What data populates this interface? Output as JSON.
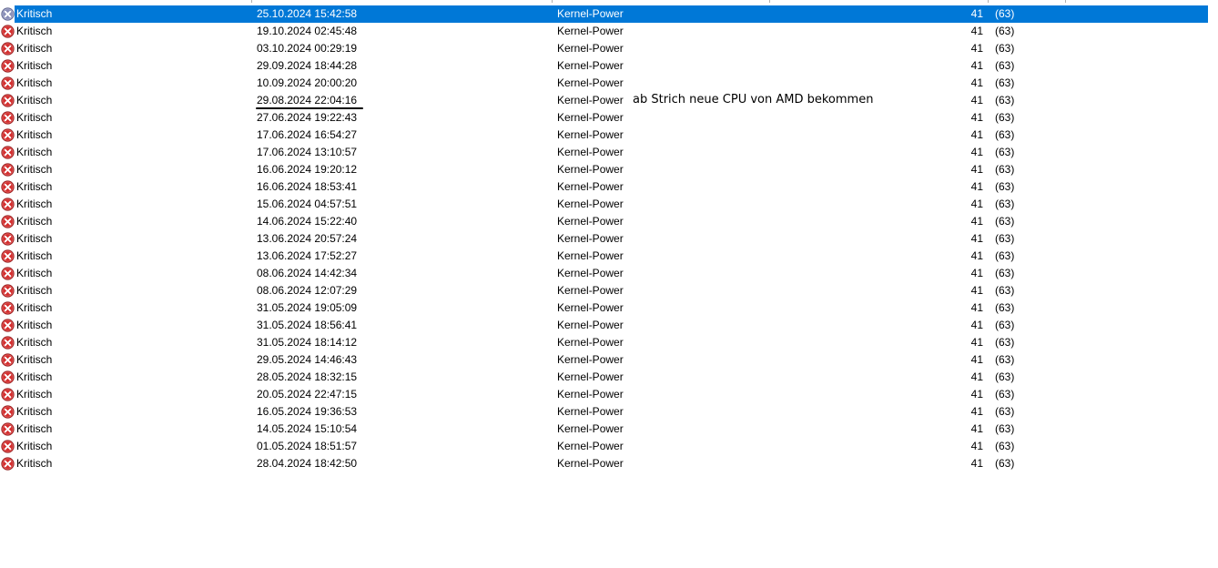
{
  "events": [
    {
      "level": "Kritisch",
      "date": "25.10.2024 15:42:58",
      "source": "Kernel-Power",
      "event_id": "41",
      "task": "(63)",
      "selected": true
    },
    {
      "level": "Kritisch",
      "date": "19.10.2024 02:45:48",
      "source": "Kernel-Power",
      "event_id": "41",
      "task": "(63)"
    },
    {
      "level": "Kritisch",
      "date": "03.10.2024 00:29:19",
      "source": "Kernel-Power",
      "event_id": "41",
      "task": "(63)"
    },
    {
      "level": "Kritisch",
      "date": "29.09.2024 18:44:28",
      "source": "Kernel-Power",
      "event_id": "41",
      "task": "(63)"
    },
    {
      "level": "Kritisch",
      "date": "10.09.2024 20:00:20",
      "source": "Kernel-Power",
      "event_id": "41",
      "task": "(63)"
    },
    {
      "level": "Kritisch",
      "date": "29.08.2024 22:04:16",
      "source": "Kernel-Power",
      "event_id": "41",
      "task": "(63)"
    },
    {
      "level": "Kritisch",
      "date": "27.06.2024 19:22:43",
      "source": "Kernel-Power",
      "event_id": "41",
      "task": "(63)"
    },
    {
      "level": "Kritisch",
      "date": "17.06.2024 16:54:27",
      "source": "Kernel-Power",
      "event_id": "41",
      "task": "(63)"
    },
    {
      "level": "Kritisch",
      "date": "17.06.2024 13:10:57",
      "source": "Kernel-Power",
      "event_id": "41",
      "task": "(63)"
    },
    {
      "level": "Kritisch",
      "date": "16.06.2024 19:20:12",
      "source": "Kernel-Power",
      "event_id": "41",
      "task": "(63)"
    },
    {
      "level": "Kritisch",
      "date": "16.06.2024 18:53:41",
      "source": "Kernel-Power",
      "event_id": "41",
      "task": "(63)"
    },
    {
      "level": "Kritisch",
      "date": "15.06.2024 04:57:51",
      "source": "Kernel-Power",
      "event_id": "41",
      "task": "(63)"
    },
    {
      "level": "Kritisch",
      "date": "14.06.2024 15:22:40",
      "source": "Kernel-Power",
      "event_id": "41",
      "task": "(63)"
    },
    {
      "level": "Kritisch",
      "date": "13.06.2024 20:57:24",
      "source": "Kernel-Power",
      "event_id": "41",
      "task": "(63)"
    },
    {
      "level": "Kritisch",
      "date": "13.06.2024 17:52:27",
      "source": "Kernel-Power",
      "event_id": "41",
      "task": "(63)"
    },
    {
      "level": "Kritisch",
      "date": "08.06.2024 14:42:34",
      "source": "Kernel-Power",
      "event_id": "41",
      "task": "(63)"
    },
    {
      "level": "Kritisch",
      "date": "08.06.2024 12:07:29",
      "source": "Kernel-Power",
      "event_id": "41",
      "task": "(63)"
    },
    {
      "level": "Kritisch",
      "date": "31.05.2024 19:05:09",
      "source": "Kernel-Power",
      "event_id": "41",
      "task": "(63)"
    },
    {
      "level": "Kritisch",
      "date": "31.05.2024 18:56:41",
      "source": "Kernel-Power",
      "event_id": "41",
      "task": "(63)"
    },
    {
      "level": "Kritisch",
      "date": "31.05.2024 18:14:12",
      "source": "Kernel-Power",
      "event_id": "41",
      "task": "(63)"
    },
    {
      "level": "Kritisch",
      "date": "29.05.2024 14:46:43",
      "source": "Kernel-Power",
      "event_id": "41",
      "task": "(63)"
    },
    {
      "level": "Kritisch",
      "date": "28.05.2024 18:32:15",
      "source": "Kernel-Power",
      "event_id": "41",
      "task": "(63)"
    },
    {
      "level": "Kritisch",
      "date": "20.05.2024 22:47:15",
      "source": "Kernel-Power",
      "event_id": "41",
      "task": "(63)"
    },
    {
      "level": "Kritisch",
      "date": "16.05.2024 19:36:53",
      "source": "Kernel-Power",
      "event_id": "41",
      "task": "(63)"
    },
    {
      "level": "Kritisch",
      "date": "14.05.2024 15:10:54",
      "source": "Kernel-Power",
      "event_id": "41",
      "task": "(63)"
    },
    {
      "level": "Kritisch",
      "date": "01.05.2024 18:51:57",
      "source": "Kernel-Power",
      "event_id": "41",
      "task": "(63)"
    },
    {
      "level": "Kritisch",
      "date": "28.04.2024 18:42:50",
      "source": "Kernel-Power",
      "event_id": "41",
      "task": "(63)"
    }
  ],
  "annotation": {
    "text": "ab Strich neue CPU von AMD bekommen"
  },
  "icons": {
    "level_icon": "critical-error-icon"
  },
  "colors": {
    "selection": "#0078d7",
    "error_red": "#d32f2f",
    "annotation_line": "#000000"
  }
}
